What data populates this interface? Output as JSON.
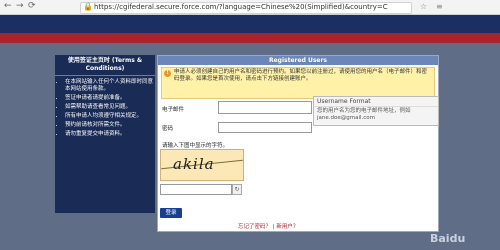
{
  "browser": {
    "back": "←",
    "forward": "→",
    "reload": "⟳",
    "url": "https://cgifederal.secure.force.com/?language=Chinese%20(Simplified)&country=C",
    "star": "☆",
    "menu": "≡"
  },
  "sidebar": {
    "title": "使用签证主页时 (Terms & Conditions)",
    "items": [
      "在本网站输入任何个人资料即时同意本网站使用条款。",
      "签证申请者请提前准备。",
      "如需帮助请查看常见问题。",
      "所有申请人均须遵守相关规定。",
      "预约前请核对所需文件。",
      "请勿重复提交申请资料。"
    ]
  },
  "main": {
    "header": "Registered Users",
    "notice": "申请人必须创建自己的用户名和密码进行预约。如果您以前注册过，请使用您的用户名（电子邮件）和密码登录。如果您是首次使用，请点击下方链接创建账户。",
    "email_label": "电子邮件",
    "password_label": "密码",
    "captcha_prompt": "请输入下图中显示的字符。",
    "captcha_text": "akila",
    "submit": "登录",
    "forgot_link": "忘记了密码？",
    "register_link": "新用户？",
    "link_separator": "|"
  },
  "tooltip": {
    "title": "Username Format",
    "body": "您的用户名为您的电子邮件地址，例如 jane.doe@gmail.com"
  },
  "watermark": "Baidu"
}
